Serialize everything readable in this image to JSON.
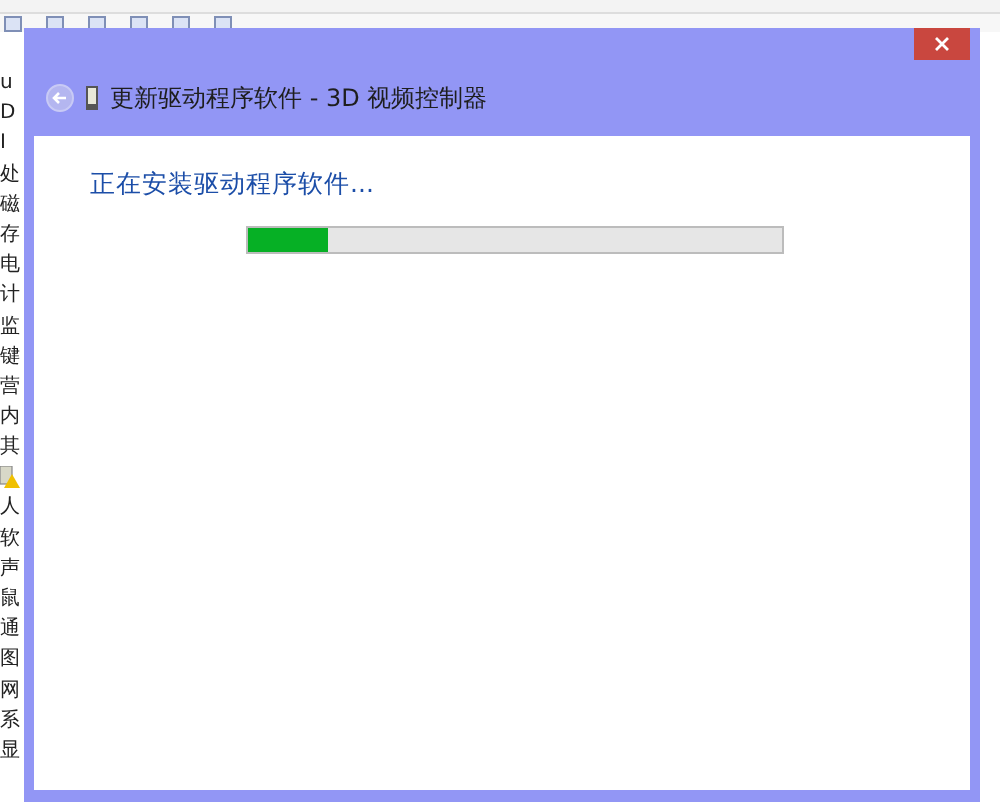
{
  "background_window": {
    "device_list": [
      {
        "kind": "text",
        "label": "u"
      },
      {
        "kind": "text",
        "label": "D"
      },
      {
        "kind": "text",
        "label": "I"
      },
      {
        "kind": "text",
        "label": "处"
      },
      {
        "kind": "text",
        "label": "磁"
      },
      {
        "kind": "text",
        "label": "存"
      },
      {
        "kind": "text",
        "label": "电"
      },
      {
        "kind": "text",
        "label": "计"
      },
      {
        "kind": "text",
        "label": "监"
      },
      {
        "kind": "text",
        "label": "键"
      },
      {
        "kind": "text",
        "label": "营"
      },
      {
        "kind": "text",
        "label": "内"
      },
      {
        "kind": "text",
        "label": "其"
      },
      {
        "kind": "warning"
      },
      {
        "kind": "text",
        "label": "人"
      },
      {
        "kind": "text",
        "label": "软"
      },
      {
        "kind": "text",
        "label": "声"
      },
      {
        "kind": "text",
        "label": "鼠"
      },
      {
        "kind": "text",
        "label": "通"
      },
      {
        "kind": "text",
        "label": "图"
      },
      {
        "kind": "text",
        "label": "网"
      },
      {
        "kind": "text",
        "label": "系"
      },
      {
        "kind": "text",
        "label": "显"
      }
    ]
  },
  "dialog": {
    "title": "更新驱动程序软件 - 3D 视频控制器",
    "status": "正在安装驱动程序软件...",
    "progress": {
      "level": 0.15
    }
  }
}
